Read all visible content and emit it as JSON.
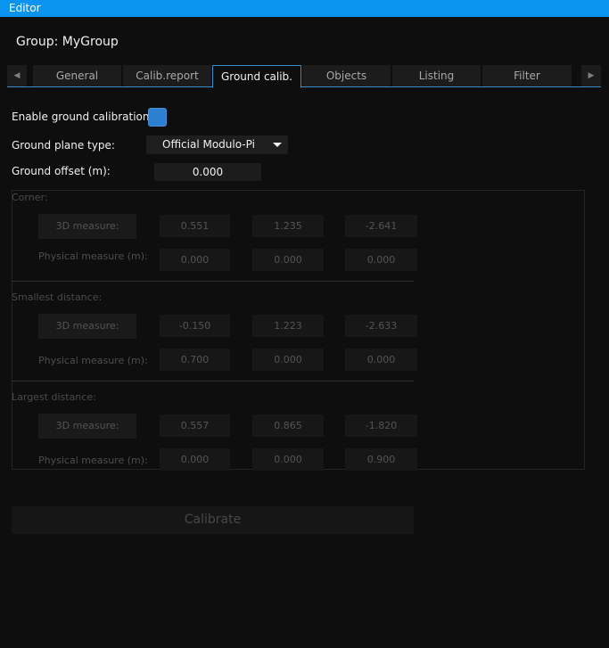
{
  "window": {
    "title": "Editor"
  },
  "group_title": "Group: MyGroup",
  "tabs": [
    {
      "label": "General"
    },
    {
      "label": "Calib.report"
    },
    {
      "label": "Ground calib."
    },
    {
      "label": "Objects"
    },
    {
      "label": "Listing"
    },
    {
      "label": "Filter"
    }
  ],
  "active_tab": "Ground calib.",
  "form": {
    "enable_label": "Enable ground calibration:",
    "enable_checked": true,
    "plane_type_label": "Ground plane type:",
    "plane_type_value": "Official Modulo-Pi",
    "offset_label": "Ground offset (m):",
    "offset_value": "0.000"
  },
  "sections": [
    {
      "label": "Corner:",
      "measure_button": "3D measure:",
      "measure_values": [
        "0.551",
        "1.235",
        "-2.641"
      ],
      "physical_label": "Physical measure (m):",
      "physical_values": [
        "0.000",
        "0.000",
        "0.000"
      ]
    },
    {
      "label": "Smallest distance:",
      "measure_button": "3D measure:",
      "measure_values": [
        "-0.150",
        "1.223",
        "-2.633"
      ],
      "physical_label": "Physical measure (m):",
      "physical_values": [
        "0.700",
        "0.000",
        "0.000"
      ]
    },
    {
      "label": "Largest distance:",
      "measure_button": "3D measure:",
      "measure_values": [
        "0.557",
        "0.865",
        "-1.820"
      ],
      "physical_label": "Physical measure (m):",
      "physical_values": [
        "0.000",
        "0.000",
        "0.900"
      ]
    }
  ],
  "calibrate_button": "Calibrate",
  "colors": {
    "accent": "#0a94f0",
    "checkbox": "#2d7fd1",
    "background": "#0e0e0e"
  }
}
